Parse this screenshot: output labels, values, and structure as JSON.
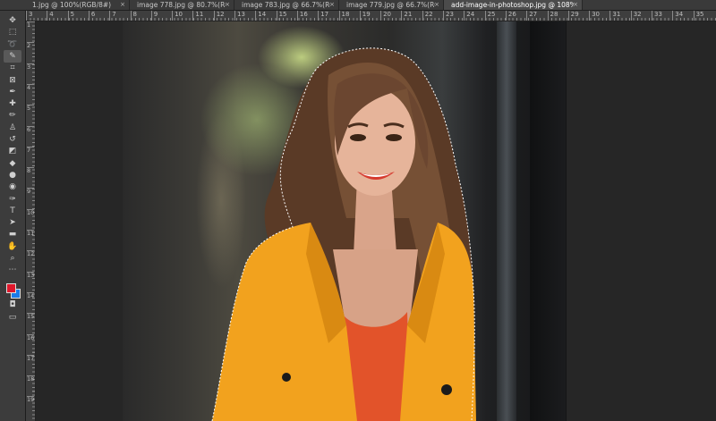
{
  "tabs": [
    {
      "label": "1.jpg @ 100%(RGB/8#)",
      "active": false
    },
    {
      "label": "image 778.jpg @ 80.7%(RGB/8#) *",
      "active": false
    },
    {
      "label": "image 783.jpg @ 66.7%(RGB/8#) *",
      "active": false
    },
    {
      "label": "image 779.jpg @ 66.7%(RGB/8#) *",
      "active": false
    },
    {
      "label": "add-image-in-photoshop.jpg @ 108%(RGB/8#)",
      "active": true
    }
  ],
  "tab_close_glyph": "×",
  "ruler_h": [
    "3",
    "4",
    "5",
    "6",
    "7",
    "8",
    "9",
    "10",
    "11",
    "12",
    "13",
    "14",
    "15",
    "16",
    "17",
    "18",
    "19",
    "20",
    "21",
    "22",
    "23",
    "24",
    "25",
    "26",
    "27",
    "28",
    "29",
    "30",
    "31",
    "32",
    "33",
    "34",
    "35"
  ],
  "ruler_v": [
    "1",
    "2",
    "3",
    "4",
    "5",
    "6",
    "7",
    "8",
    "9",
    "10",
    "11",
    "12",
    "13",
    "14",
    "15",
    "16",
    "17",
    "18",
    "19"
  ],
  "tools": [
    {
      "name": "move-tool",
      "icon": "move-icon",
      "glyph": "✥"
    },
    {
      "name": "marquee-tool",
      "icon": "marquee-icon",
      "glyph": "⬚"
    },
    {
      "name": "lasso-tool",
      "icon": "lasso-icon",
      "glyph": "➰"
    },
    {
      "name": "quick-selection-tool",
      "icon": "quick-selection-icon",
      "glyph": "✎",
      "active": true
    },
    {
      "name": "crop-tool",
      "icon": "crop-icon",
      "glyph": "⌗"
    },
    {
      "name": "frame-tool",
      "icon": "frame-icon",
      "glyph": "⊠"
    },
    {
      "name": "eyedropper-tool",
      "icon": "eyedropper-icon",
      "glyph": "✒"
    },
    {
      "name": "healing-brush-tool",
      "icon": "healing-brush-icon",
      "glyph": "✚"
    },
    {
      "name": "brush-tool",
      "icon": "brush-icon",
      "glyph": "✏"
    },
    {
      "name": "clone-stamp-tool",
      "icon": "clone-stamp-icon",
      "glyph": "♙"
    },
    {
      "name": "history-brush-tool",
      "icon": "history-brush-icon",
      "glyph": "↺"
    },
    {
      "name": "eraser-tool",
      "icon": "eraser-icon",
      "glyph": "◩"
    },
    {
      "name": "paint-bucket-tool",
      "icon": "paint-bucket-icon",
      "glyph": "◆"
    },
    {
      "name": "blur-tool",
      "icon": "blur-icon",
      "glyph": "●"
    },
    {
      "name": "dodge-tool",
      "icon": "dodge-icon",
      "glyph": "◉"
    },
    {
      "name": "pen-tool",
      "icon": "pen-icon",
      "glyph": "✑"
    },
    {
      "name": "type-tool",
      "icon": "type-icon",
      "glyph": "T"
    },
    {
      "name": "path-selection-tool",
      "icon": "path-selection-icon",
      "glyph": "➤"
    },
    {
      "name": "rectangle-tool",
      "icon": "rectangle-icon",
      "glyph": "▬"
    },
    {
      "name": "hand-tool",
      "icon": "hand-icon",
      "glyph": "✋"
    },
    {
      "name": "zoom-tool",
      "icon": "zoom-icon",
      "glyph": "⌕"
    },
    {
      "name": "edit-toolbar",
      "icon": "more-tools-icon",
      "glyph": "⋯"
    }
  ],
  "lower_tools": [
    {
      "name": "quick-mask-button",
      "icon": "quick-mask-icon",
      "glyph": "◘"
    },
    {
      "name": "screen-mode-button",
      "icon": "screen-mode-icon",
      "glyph": "▭"
    }
  ],
  "colors": {
    "foreground": "#e0172b",
    "background": "#1b7be8",
    "ui_panel": "#3c3c3c",
    "canvas_bg": "#262626",
    "jacket": "#f2a21e",
    "top": "#e2532a"
  }
}
